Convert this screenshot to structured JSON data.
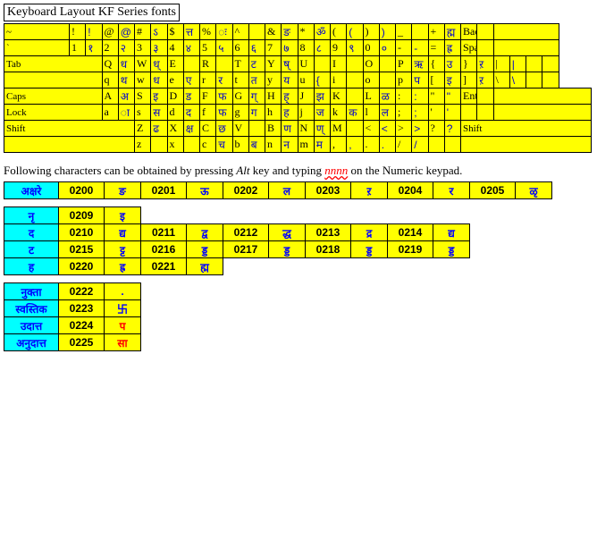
{
  "title": "Keyboard Layout KF Series fonts",
  "kb": {
    "r": [
      [
        "~",
        "ऽ",
        "!",
        "!",
        "@",
        "@",
        "#",
        "ऽ",
        "$",
        "त्त",
        "%",
        "ः",
        "^",
        "",
        "&",
        "ङ",
        "*",
        "ॐ",
        "(",
        "(",
        ")",
        ")",
        "_",
        "",
        "+",
        "ह्म",
        "Back"
      ],
      [
        "`",
        "",
        "1",
        "१",
        "2",
        "२",
        "3",
        "३",
        "4",
        "४",
        "5",
        "५",
        "6",
        "६",
        "7",
        "७",
        "8",
        "८",
        "9",
        "९",
        "0",
        "०",
        "-",
        "-",
        "=",
        "ह्र",
        "Space"
      ],
      [
        "Tab",
        "",
        "Q",
        "ध",
        "W",
        "ध्",
        "E",
        "",
        "R",
        "",
        "T",
        "ट",
        "Y",
        "ष्",
        "U",
        "",
        "I",
        "",
        "O",
        "",
        "P",
        "ऋ",
        "{",
        "उ",
        "}",
        "ऱ",
        "|",
        "|"
      ],
      [
        "",
        "",
        "q",
        "थ",
        "w",
        "ध",
        "e",
        "ए",
        "r",
        "र",
        "t",
        "त",
        "y",
        "य",
        "u",
        "{",
        "i",
        "",
        "o",
        "",
        "p",
        "प",
        "[",
        "इ",
        "]",
        "ऱ",
        "\\",
        "\\"
      ],
      [
        "Caps",
        "",
        "A",
        "अ",
        "S",
        "इ",
        "D",
        "ड",
        "F",
        "फ",
        "G",
        "ग्",
        "H",
        "ह्",
        "J",
        "झ",
        "K",
        "",
        "L",
        "ळ",
        ":",
        ":",
        "\"",
        "\"",
        "Enter",
        ""
      ],
      [
        "Lock",
        "",
        "a",
        "ा",
        "s",
        "स",
        "d",
        "द",
        "f",
        "फ",
        "g",
        "ग",
        "h",
        "ह",
        "j",
        "ज",
        "k",
        "क",
        "l",
        "ल",
        ";",
        ";",
        "'",
        "'",
        "",
        ""
      ],
      [
        "Shift",
        "",
        "Z",
        "ढ",
        "X",
        "क्ष",
        "C",
        "छ",
        "V",
        "",
        "B",
        "ण",
        "N",
        "ण्",
        "M",
        "",
        "<",
        "<",
        ">",
        ">",
        "?",
        "?",
        "Shift",
        ""
      ],
      [
        "",
        "",
        "z",
        "",
        "x",
        "",
        "c",
        "च",
        "b",
        "ब",
        "n",
        "न",
        "m",
        "म",
        ",",
        ",",
        ".",
        ".",
        "/",
        "/",
        "",
        ""
      ]
    ]
  },
  "note": {
    "a": "Following characters can be obtained by pressing ",
    "b": "Alt",
    "c": " key and typing ",
    "d": "nnnn",
    "e": " on the Numeric keypad."
  },
  "alt1": {
    "hdr": "अक्षरे",
    "c": [
      [
        "0200",
        "ङ"
      ],
      [
        "0201",
        "ऊ"
      ],
      [
        "0202",
        "ल"
      ],
      [
        "0203",
        "ऱ"
      ],
      [
        "0204",
        "र"
      ],
      [
        "0205",
        "ळृ"
      ]
    ]
  },
  "alt2": [
    {
      "hdr": "नृ",
      "c": [
        [
          "0209",
          "इ"
        ]
      ]
    },
    {
      "hdr": "द",
      "c": [
        [
          "0210",
          "द्य"
        ],
        [
          "0211",
          "द्व"
        ],
        [
          "0212",
          "द्ध"
        ],
        [
          "0213",
          "द्र"
        ],
        [
          "0214",
          "द्य"
        ]
      ]
    },
    {
      "hdr": "ट",
      "c": [
        [
          "0215",
          "ट्ट"
        ],
        [
          "0216",
          "ड्ड"
        ],
        [
          "0217",
          "ड्ड"
        ],
        [
          "0218",
          "ड्ड"
        ],
        [
          "0219",
          "ड्ड"
        ]
      ]
    },
    {
      "hdr": "ह",
      "c": [
        [
          "0220",
          "ह्र"
        ],
        [
          "0221",
          "ह्म"
        ]
      ]
    }
  ],
  "alt3": [
    {
      "hdr": "नुक्ता",
      "c": [
        "0222",
        "."
      ]
    },
    {
      "hdr": "स्वस्तिक",
      "c": [
        "0223",
        "卐"
      ]
    },
    {
      "hdr": "उदात्त",
      "c": [
        "0224",
        "प"
      ],
      "red": true
    },
    {
      "hdr": "अनुदात्त",
      "c": [
        "0225",
        "सा"
      ],
      "red": true
    }
  ]
}
